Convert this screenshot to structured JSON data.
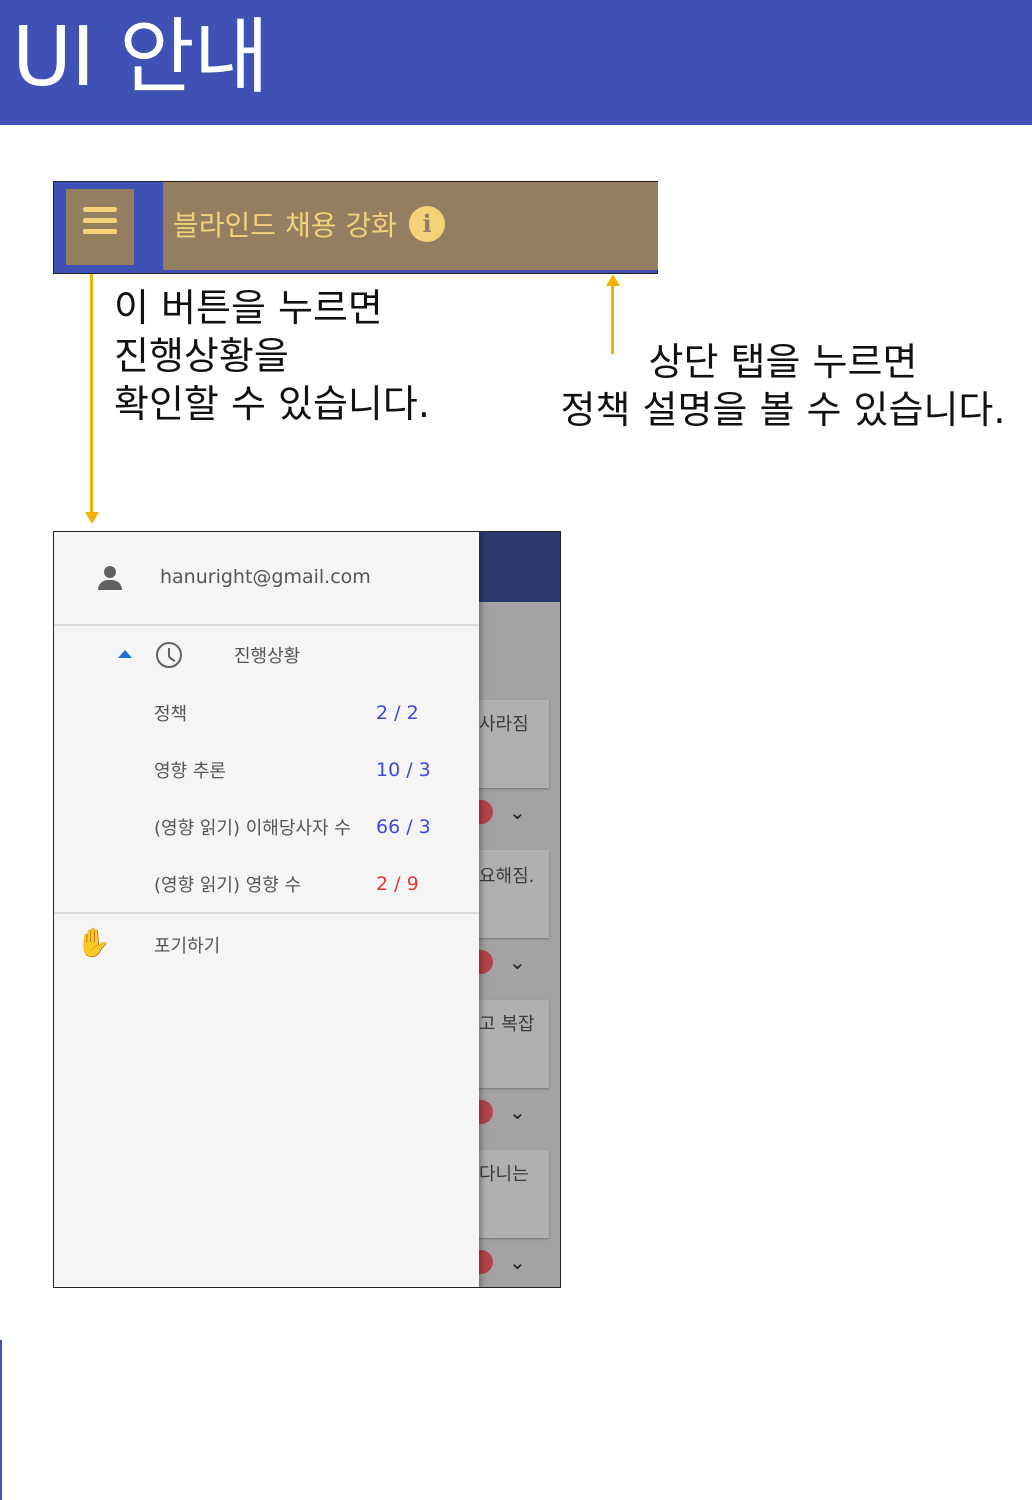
{
  "banner": {
    "title": "UI 안내"
  },
  "appbar": {
    "menu_icon": "hamburger-menu-icon",
    "policy_tab_label": "블라인드 채용 강화",
    "info_icon": "info-icon",
    "info_glyph": "i",
    "accent_color": "#f4d27a",
    "tab_color": "#937f5f",
    "bar_color": "#3f51b5"
  },
  "notes": {
    "menu_note": "이 버튼을 누르면\n진행상황을\n확인할 수 있습니다.",
    "tab_note": "상단 탭을 누르면\n정책 설명을 볼 수 있습니다."
  },
  "drawer": {
    "email": "hanuright@gmail.com",
    "progress_title": "진행상황",
    "items": [
      {
        "label": "정책",
        "value": "2 / 2",
        "color": "#3a4bd9"
      },
      {
        "label": "영향 추론",
        "value": "10 / 3",
        "color": "#3a4bd9"
      },
      {
        "label": "(영향 읽기) 이해당사자 수",
        "value": "66 / 3",
        "color": "#3a4bd9"
      },
      {
        "label": "(영향 읽기) 영향 수",
        "value": "2 / 9",
        "color": "#e53935"
      }
    ],
    "give_up_label": "포기하기"
  },
  "background_cards": {
    "texts": [
      "사라짐",
      "요해짐.",
      "고 복잡",
      "다니는"
    ]
  }
}
